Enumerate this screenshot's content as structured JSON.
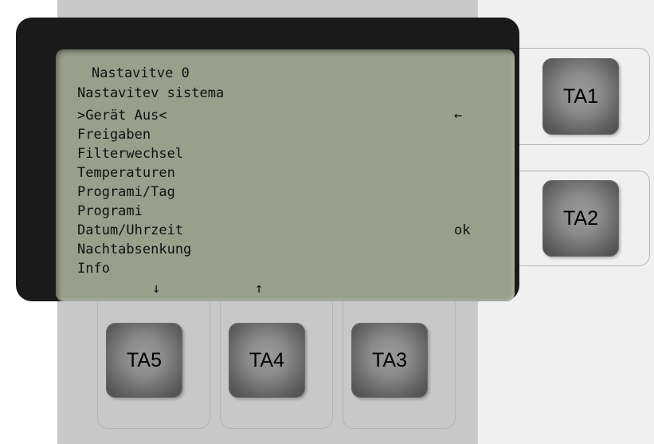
{
  "display": {
    "title": "Nastavitve 0",
    "subtitle": "Nastavitev sistema",
    "menu_items": [
      ">Gerät Aus<",
      "Freigaben",
      "Filterwechsel",
      "Temperaturen",
      "Programi/Tag",
      "Programi",
      "Datum/Uhrzeit",
      "Nachtabsenkung",
      "Info"
    ],
    "back_arrow": "←",
    "ok_label": "ok",
    "down_arrow": "↓",
    "up_arrow": "↑"
  },
  "keys": {
    "ta1": "TA1",
    "ta2": "TA2",
    "ta3": "TA3",
    "ta4": "TA4",
    "ta5": "TA5"
  },
  "colors": {
    "lcd_background": "#98a08c",
    "bezel": "#1a1a1a",
    "panel": "#c8c8c8"
  }
}
